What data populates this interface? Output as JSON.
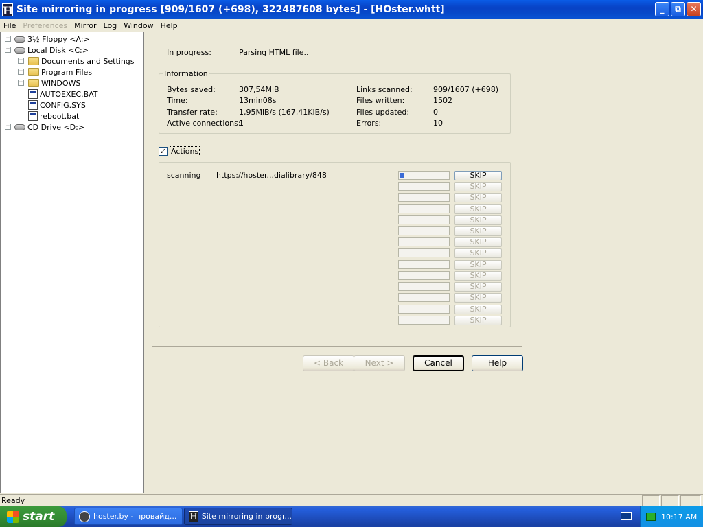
{
  "window": {
    "title": "Site mirroring in progress [909/1607 (+698), 322487608 bytes] - [HOster.whtt]",
    "icon_glyph": "H",
    "minimize_glyph": "_",
    "maximize_glyph": "⧉",
    "close_glyph": "✕"
  },
  "menu": {
    "file": "File",
    "preferences": "Preferences",
    "mirror": "Mirror",
    "log": "Log",
    "window": "Window",
    "help": "Help"
  },
  "tree": {
    "floppy": "3½ Floppy <A:>",
    "local_disk": "Local Disk <C:>",
    "documents": "Documents and Settings",
    "program_files": "Program Files",
    "windows": "WINDOWS",
    "autoexec": "AUTOEXEC.BAT",
    "config": "CONFIG.SYS",
    "reboot": "reboot.bat",
    "cd_drive": "CD Drive <D:>",
    "expand_glyph": "+",
    "collapse_glyph": "−"
  },
  "progress": {
    "in_progress_label": "In progress:",
    "in_progress_value": "Parsing HTML file.."
  },
  "information": {
    "legend": "Information",
    "bytes_saved_label": "Bytes saved:",
    "bytes_saved_value": "307,54MiB",
    "time_label": "Time:",
    "time_value": "13min08s",
    "transfer_rate_label": "Transfer rate:",
    "transfer_rate_value": "1,95MiB/s (167,41KiB/s)",
    "active_connections_label": "Active connections:",
    "active_connections_value": "1",
    "links_scanned_label": "Links scanned:",
    "links_scanned_value": "909/1607 (+698)",
    "files_written_label": "Files written:",
    "files_written_value": "1502",
    "files_updated_label": "Files updated:",
    "files_updated_value": "0",
    "errors_label": "Errors:",
    "errors_value": "10"
  },
  "actions": {
    "checkbox_label": "Actions",
    "checked_glyph": "✓",
    "first_status": "scanning",
    "first_url": "https://hoster...dialibrary/848",
    "first_progress": 0.08,
    "skip_label": "SKIP"
  },
  "buttons": {
    "back": "< Back",
    "next": "Next >",
    "cancel": "Cancel",
    "help": "Help"
  },
  "status": {
    "text": "Ready"
  },
  "taskbar": {
    "start": "start",
    "item1": "hoster.by - провайд...",
    "item2": "Site mirroring in progr...",
    "clock": "10:17 AM"
  }
}
